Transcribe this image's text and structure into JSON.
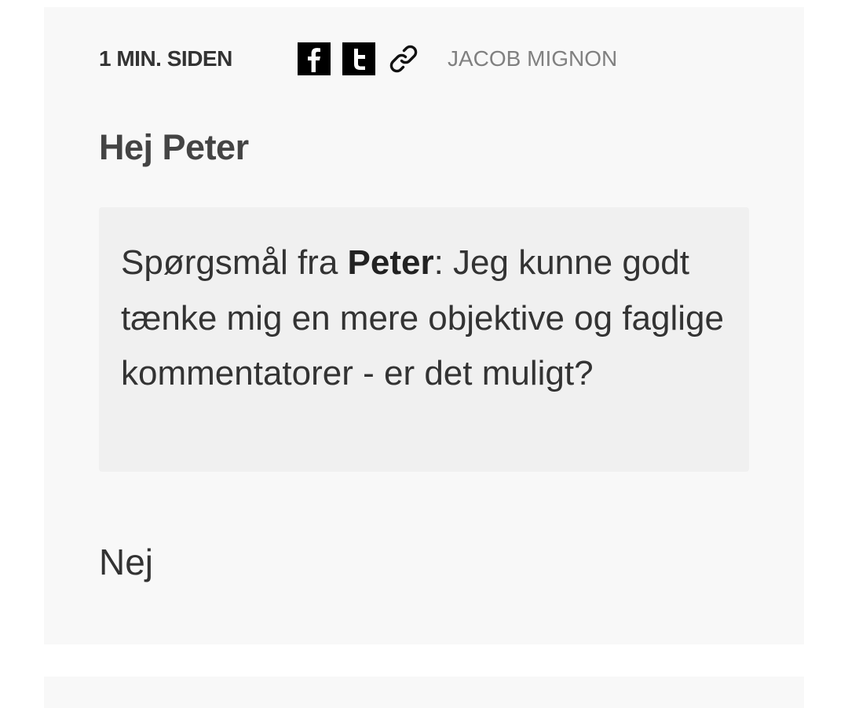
{
  "post": {
    "timestamp": "1 MIN. SIDEN",
    "author": "JACOB MIGNON",
    "title": "Hej Peter",
    "question": {
      "prefix": "Spørgsmål fra ",
      "asker": "Peter",
      "text": ": Jeg kunne godt tænke mig en mere objektive og faglige kommentatorer - er det muligt?"
    },
    "answer": "Nej"
  },
  "share": {
    "icons": [
      "facebook-icon",
      "twitter-icon",
      "link-icon"
    ]
  },
  "colors": {
    "card_background": "#f8f8f8",
    "question_background": "#f0f0f0",
    "share_button_background": "#000000",
    "author_text": "#808080",
    "body_text": "#333333"
  }
}
